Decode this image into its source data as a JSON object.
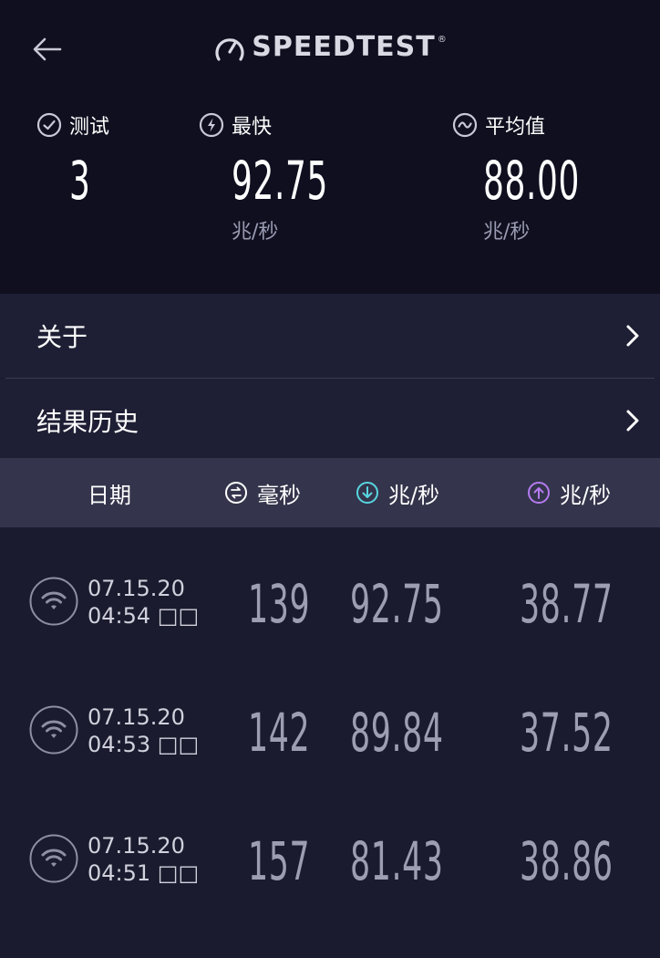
{
  "header": {
    "brand": "SPEEDTEST",
    "brand_tm": "®"
  },
  "stats": {
    "tests": {
      "label": "测试",
      "value": "3",
      "icon": "check-circle-icon"
    },
    "fastest": {
      "label": "最快",
      "value": "92.75",
      "unit": "兆/秒",
      "icon": "bolt-circle-icon"
    },
    "average": {
      "label": "平均值",
      "value": "88.00",
      "unit": "兆/秒",
      "icon": "wave-circle-icon"
    }
  },
  "menu": {
    "about": "关于",
    "history": "结果历史"
  },
  "table": {
    "headers": {
      "date": "日期",
      "ping": "毫秒",
      "download": "兆/秒",
      "upload": "兆/秒"
    },
    "rows": [
      {
        "date": "07.15.20",
        "time": "04:54 □□",
        "ping": "139",
        "download": "92.75",
        "upload": "38.77"
      },
      {
        "date": "07.15.20",
        "time": "04:53 □□",
        "ping": "142",
        "download": "89.84",
        "upload": "37.52"
      },
      {
        "date": "07.15.20",
        "time": "04:51 □□",
        "ping": "157",
        "download": "81.43",
        "upload": "38.86"
      }
    ]
  },
  "colors": {
    "header_bg": "#0f0f1f",
    "page_bg": "#1b1b2f",
    "table_header_bg": "#34354c",
    "download_accent": "#58d6e0",
    "upload_accent": "#b57bf0"
  }
}
